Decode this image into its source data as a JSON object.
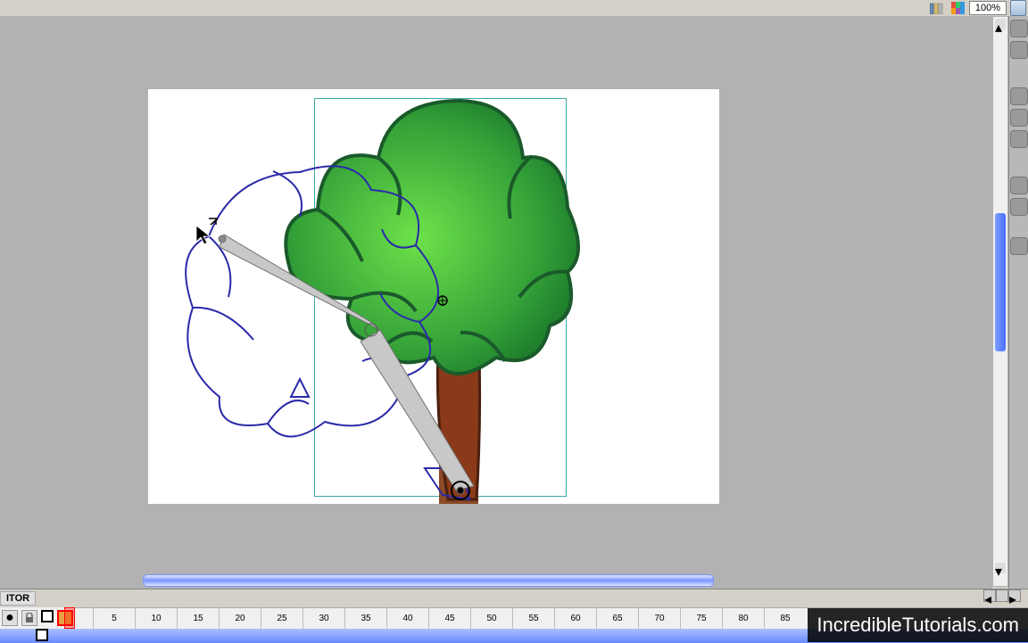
{
  "topbar": {
    "zoom_value": "100%",
    "icons": {
      "library": "library-books",
      "colors": "color-swatches"
    }
  },
  "right_panel": {
    "items": [
      "globe-icon",
      "swatches-icon",
      "color-panel-icon",
      "help-icon",
      "actions-icon",
      "align-icon",
      "library-panel-icon"
    ]
  },
  "timeline": {
    "editor_label": "ITOR",
    "layer_icons": [
      "eye-icon",
      "lock-icon",
      "outline-icon",
      "fill-square-icon"
    ],
    "frame_marks": [
      5,
      10,
      15,
      20,
      25,
      30,
      35,
      40,
      45,
      50,
      55,
      60,
      65,
      70,
      75,
      80,
      85
    ],
    "playhead_frame": 1
  },
  "watermark": {
    "text": "IncredibleTutorials.com"
  },
  "canvas": {
    "description": "Green cartoon tree with brown trunk; blue outline tree copy to left with bone armature overlaid; selection bounding box around green tree."
  }
}
